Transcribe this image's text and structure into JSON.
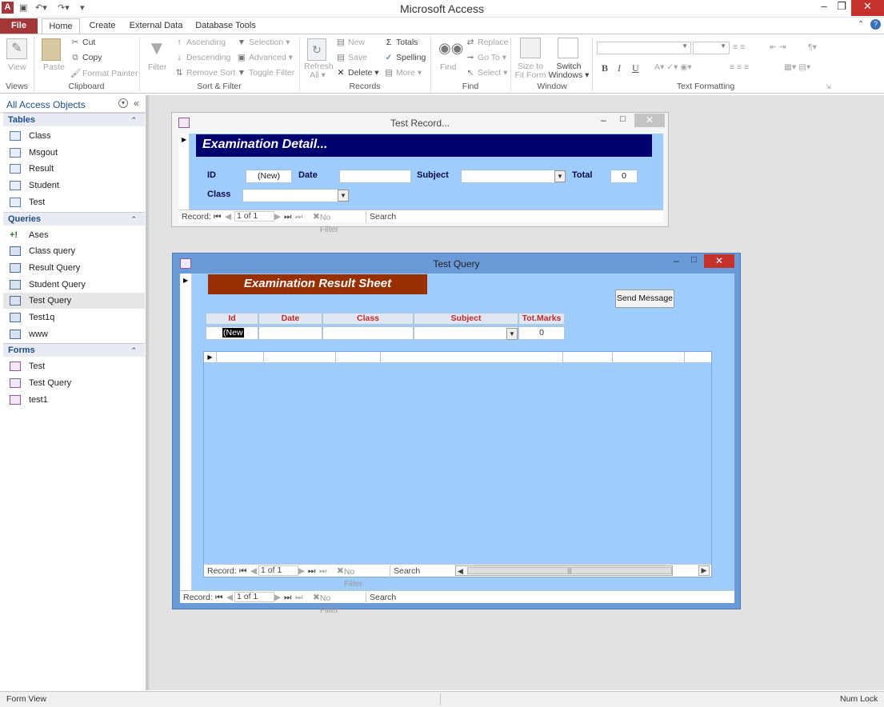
{
  "app": {
    "title": "Microsoft Access"
  },
  "tabs": [
    "File",
    "Home",
    "Create",
    "External Data",
    "Database Tools"
  ],
  "ribbon": {
    "views": {
      "view": "View",
      "label": "Views"
    },
    "clipboard": {
      "paste": "Paste",
      "cut": "Cut",
      "copy": "Copy",
      "format_painter": "Format Painter",
      "label": "Clipboard"
    },
    "sort_filter": {
      "filter": "Filter",
      "ascending": "Ascending",
      "descending": "Descending",
      "remove_sort": "Remove Sort",
      "selection": "Selection",
      "advanced": "Advanced",
      "toggle_filter": "Toggle Filter",
      "label": "Sort & Filter"
    },
    "records": {
      "refresh": "Refresh",
      "refresh2": "All",
      "new": "New",
      "save": "Save",
      "delete": "Delete",
      "totals": "Totals",
      "spelling": "Spelling",
      "more": "More",
      "label": "Records"
    },
    "find": {
      "find": "Find",
      "replace": "Replace",
      "goto": "Go To",
      "select": "Select",
      "label": "Find"
    },
    "window": {
      "size_fit": "Size to",
      "size_fit2": "Fit Form",
      "switch": "Switch",
      "switch2": "Windows",
      "label": "Window"
    },
    "text_formatting": {
      "bold": "B",
      "italic": "I",
      "underline": "U",
      "label": "Text Formatting"
    }
  },
  "nav": {
    "header": "All Access Objects",
    "sections": [
      {
        "title": "Tables",
        "items": [
          "Class",
          "Msgout",
          "Result",
          "Student",
          "Test"
        ]
      },
      {
        "title": "Queries",
        "items": [
          "Ases",
          "Class query",
          "Result Query",
          "Student Query",
          "Test Query",
          "Test1q",
          "www"
        ]
      },
      {
        "title": "Forms",
        "items": [
          "Test",
          "Test Query",
          "test1"
        ]
      }
    ]
  },
  "win_record": {
    "title": "Test Record...",
    "header": "Examination Detail...",
    "id_label": "ID",
    "id_value": "(New)",
    "date_label": "Date",
    "subject_label": "Subject",
    "total_label": "Total",
    "total_value": "0",
    "class_label": "Class",
    "recbar": {
      "record": "Record:",
      "pos": "1 of 1",
      "nofilter": "No Filter",
      "search": "Search"
    }
  },
  "win_query": {
    "title": "Test Query",
    "header": "Examination Result Sheet",
    "send": "Send Message",
    "columns": [
      "Id",
      "Date",
      "Class",
      "Subject",
      "Tot.Marks"
    ],
    "row": {
      "id": "(New",
      "tot": "0"
    },
    "sub_recbar": {
      "record": "Record:",
      "pos": "1 of 1",
      "nofilter": "No Filter",
      "search": "Search"
    },
    "recbar": {
      "record": "Record:",
      "pos": "1 of 1",
      "nofilter": "No Filter",
      "search": "Search"
    }
  },
  "status": {
    "left": "Form View",
    "right": "Num Lock"
  }
}
